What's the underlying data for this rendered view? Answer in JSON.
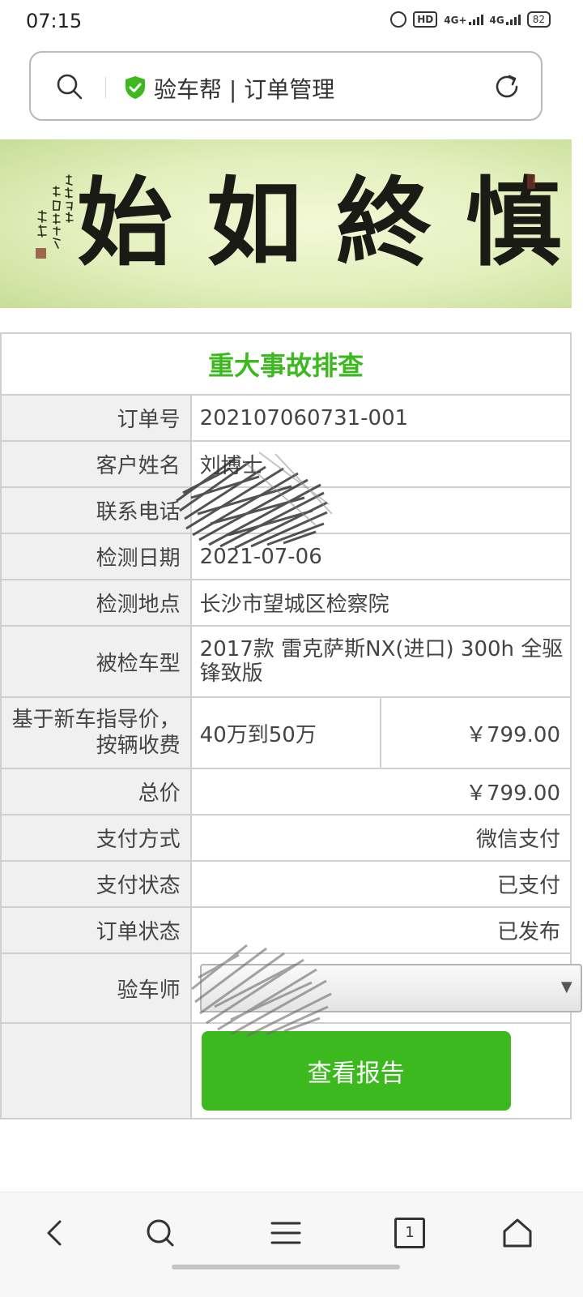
{
  "status_bar": {
    "time": "07:15",
    "hd_label": "HD",
    "network_1": "4G+",
    "network_2": "4G",
    "battery": "82"
  },
  "address_bar": {
    "title": "验车帮 | 订单管理",
    "icons": [
      "search-icon",
      "shield-check-icon",
      "refresh-icon"
    ]
  },
  "banner": {
    "calligraphy": [
      "始",
      "如",
      "終",
      "慎"
    ]
  },
  "order": {
    "title": "重大事故排查",
    "rows": {
      "order_no": {
        "label": "订单号",
        "value": "202107060731-001"
      },
      "customer_name": {
        "label": "客户姓名",
        "value": "刘博士"
      },
      "contact_phone": {
        "label": "联系电话",
        "value": ""
      },
      "inspection_date": {
        "label": "检测日期",
        "value": "2021-07-06"
      },
      "inspection_location": {
        "label": "检测地点",
        "value": "长沙市望城区检察院"
      },
      "vehicle_model": {
        "label": "被检车型",
        "value": "2017款 雷克萨斯NX(进口) 300h 全驱 锋致版"
      },
      "fee": {
        "label": "基于新车指导价，按辆收费",
        "range": "40万到50万",
        "price": "￥799.00"
      },
      "total": {
        "label": "总价",
        "value": "￥799.00"
      },
      "payment_method": {
        "label": "支付方式",
        "value": "微信支付"
      },
      "payment_status": {
        "label": "支付状态",
        "value": "已支付"
      },
      "order_status": {
        "label": "订单状态",
        "value": "已发布"
      },
      "inspector": {
        "label": "验车师",
        "selected": ""
      }
    },
    "view_report_label": "查看报告"
  },
  "nav": {
    "tab_count": "1",
    "icons": [
      "back-icon",
      "search-icon",
      "menu-icon",
      "tabs-icon",
      "home-icon"
    ]
  },
  "colors": {
    "accent_green": "#3cb91f",
    "label_bg": "#f0f0f0",
    "border": "#cfcfcf"
  }
}
